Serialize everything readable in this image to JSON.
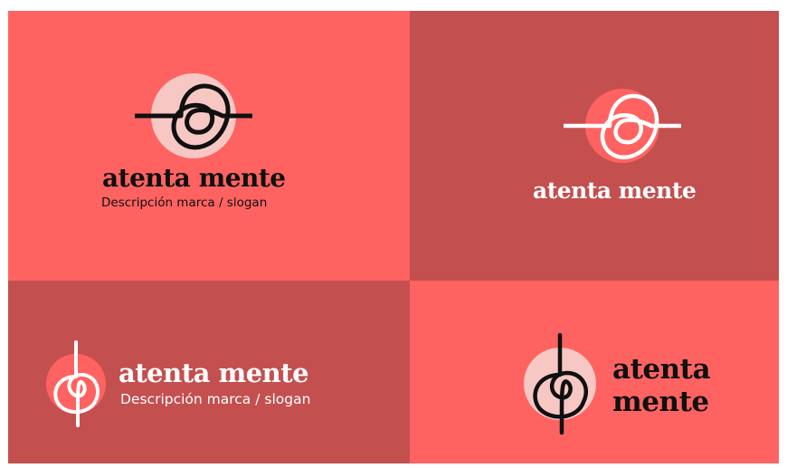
{
  "brand": {
    "name": "atenta mente",
    "name_line_1": "atenta",
    "name_line_2": "mente",
    "slogan": "Descripción marca / slogan"
  },
  "colors": {
    "coral": "#ff6361",
    "dark_coral": "#c44f4f",
    "pink_disc": "#f7c7c4",
    "ink": "#101010",
    "white": "#ffffff"
  },
  "panels": [
    {
      "variant": "horizontal-mark-with-name-and-slogan",
      "background": "coral",
      "text_color": "ink"
    },
    {
      "variant": "horizontal-mark-with-name",
      "background": "dark_coral",
      "text_color": "white"
    },
    {
      "variant": "vertical-mark-left-with-name-and-slogan",
      "background": "dark_coral",
      "text_color": "white"
    },
    {
      "variant": "vertical-mark-left-with-stacked-name",
      "background": "coral",
      "text_color": "ink"
    }
  ]
}
